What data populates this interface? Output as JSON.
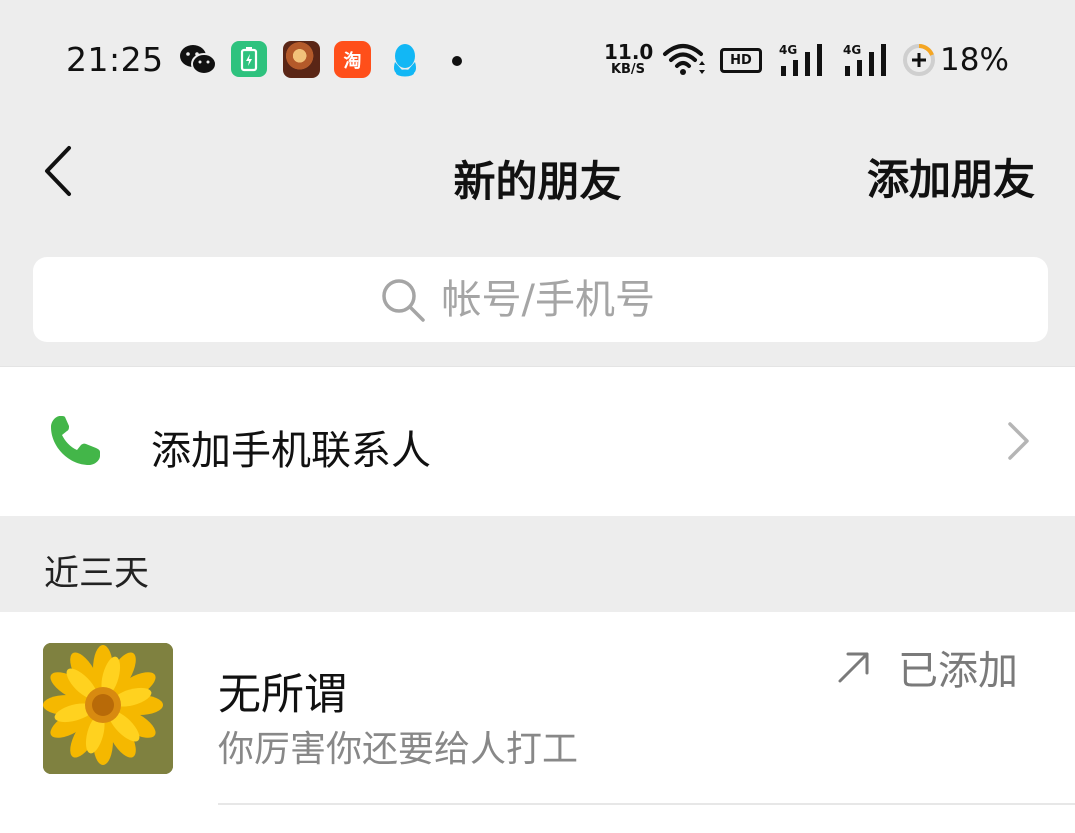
{
  "status_bar": {
    "time": "21:25",
    "net_speed_value": "11.0",
    "net_speed_unit": "KB/S",
    "hd_label": "HD",
    "signal_1_type": "4G",
    "signal_2_type": "4G",
    "battery_percent": "18%",
    "icons": [
      "wechat-icon",
      "battery-app-icon",
      "game-app-icon",
      "taobao-app-icon",
      "qq-icon",
      "notification-dot",
      "wifi-icon",
      "hd-icon",
      "signal-icon",
      "signal-icon",
      "battery-icon"
    ],
    "taobao_glyph": "淘"
  },
  "nav": {
    "title": "新的朋友",
    "right_action": "添加朋友",
    "back_icon": "chevron-left-icon"
  },
  "search": {
    "placeholder": "帐号/手机号",
    "value": ""
  },
  "add_contacts": {
    "label": "添加手机联系人",
    "icon": "phone-icon",
    "icon_color": "#43b649"
  },
  "section": {
    "header": "近三天"
  },
  "requests": [
    {
      "name": "无所谓",
      "message": "你厉害你还要给人打工",
      "status": "已添加",
      "status_icon": "arrow-up-right-icon"
    }
  ],
  "colors": {
    "background": "#ededed",
    "card": "#ffffff",
    "accent_green": "#43b649",
    "muted_text": "#888888"
  }
}
